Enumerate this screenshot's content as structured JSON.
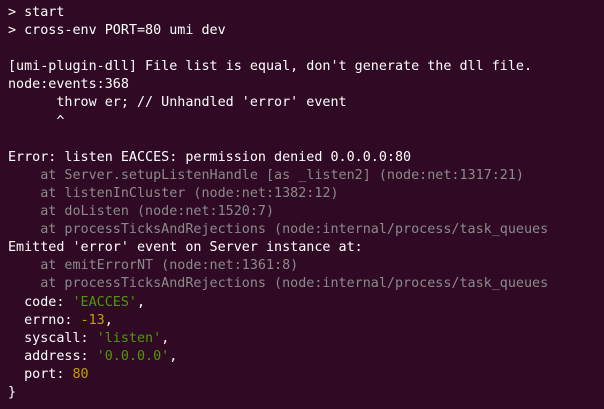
{
  "terminal": {
    "lines": [
      {
        "id": "cmd-start",
        "segments": [
          {
            "t": "> start",
            "c": "white"
          }
        ]
      },
      {
        "id": "cmd-crossenv",
        "segments": [
          {
            "t": "> cross-env PORT=80 umi dev",
            "c": "white"
          }
        ]
      },
      {
        "id": "blank-1",
        "segments": [
          {
            "t": "",
            "c": "white"
          }
        ]
      },
      {
        "id": "dll-msg",
        "segments": [
          {
            "t": "[umi-plugin-dll] File list is equal, don't generate the dll file.",
            "c": "white"
          }
        ]
      },
      {
        "id": "node-events",
        "segments": [
          {
            "t": "node:events:368",
            "c": "white"
          }
        ]
      },
      {
        "id": "throw-er",
        "segments": [
          {
            "t": "      throw er; // Unhandled 'error' event",
            "c": "white"
          }
        ]
      },
      {
        "id": "caret",
        "segments": [
          {
            "t": "      ^",
            "c": "white"
          }
        ]
      },
      {
        "id": "blank-2",
        "segments": [
          {
            "t": "",
            "c": "white"
          }
        ]
      },
      {
        "id": "error-msg",
        "segments": [
          {
            "t": "Error: listen EACCES: permission denied 0.0.0.0:80",
            "c": "white"
          }
        ]
      },
      {
        "id": "stack-1",
        "segments": [
          {
            "t": "    at Server.setupListenHandle [as _listen2] (node:net:1317:21)",
            "c": "gray"
          }
        ]
      },
      {
        "id": "stack-2",
        "segments": [
          {
            "t": "    at listenInCluster (node:net:1382:12)",
            "c": "gray"
          }
        ]
      },
      {
        "id": "stack-3",
        "segments": [
          {
            "t": "    at doListen (node:net:1520:7)",
            "c": "gray"
          }
        ]
      },
      {
        "id": "stack-4",
        "segments": [
          {
            "t": "    at processTicksAndRejections (node:internal/process/task_queues",
            "c": "gray"
          }
        ]
      },
      {
        "id": "emitted-msg",
        "segments": [
          {
            "t": "Emitted 'error' event on Server instance at:",
            "c": "white"
          }
        ]
      },
      {
        "id": "stack-5",
        "segments": [
          {
            "t": "    at emitErrorNT (node:net:1361:8)",
            "c": "gray"
          }
        ]
      },
      {
        "id": "stack-6",
        "segments": [
          {
            "t": "    at processTicksAndRejections (node:internal/process/task_queues",
            "c": "gray"
          }
        ]
      },
      {
        "id": "prop-code",
        "segments": [
          {
            "t": "  code: ",
            "c": "white"
          },
          {
            "t": "'EACCES'",
            "c": "green"
          },
          {
            "t": ",",
            "c": "white"
          }
        ]
      },
      {
        "id": "prop-errno",
        "segments": [
          {
            "t": "  errno: ",
            "c": "white"
          },
          {
            "t": "-13",
            "c": "yellow"
          },
          {
            "t": ",",
            "c": "white"
          }
        ]
      },
      {
        "id": "prop-syscall",
        "segments": [
          {
            "t": "  syscall: ",
            "c": "white"
          },
          {
            "t": "'listen'",
            "c": "green"
          },
          {
            "t": ",",
            "c": "white"
          }
        ]
      },
      {
        "id": "prop-address",
        "segments": [
          {
            "t": "  address: ",
            "c": "white"
          },
          {
            "t": "'0.0.0.0'",
            "c": "green"
          },
          {
            "t": ",",
            "c": "white"
          }
        ]
      },
      {
        "id": "prop-port",
        "segments": [
          {
            "t": "  port: ",
            "c": "white"
          },
          {
            "t": "80",
            "c": "yellow"
          }
        ]
      },
      {
        "id": "closing-brace",
        "segments": [
          {
            "t": "}",
            "c": "white"
          }
        ]
      }
    ]
  },
  "colors": {
    "background": "#300a24",
    "text": "#ffffff",
    "dim": "#8a8a8a",
    "string": "#4e9a06",
    "number": "#c4a000"
  }
}
